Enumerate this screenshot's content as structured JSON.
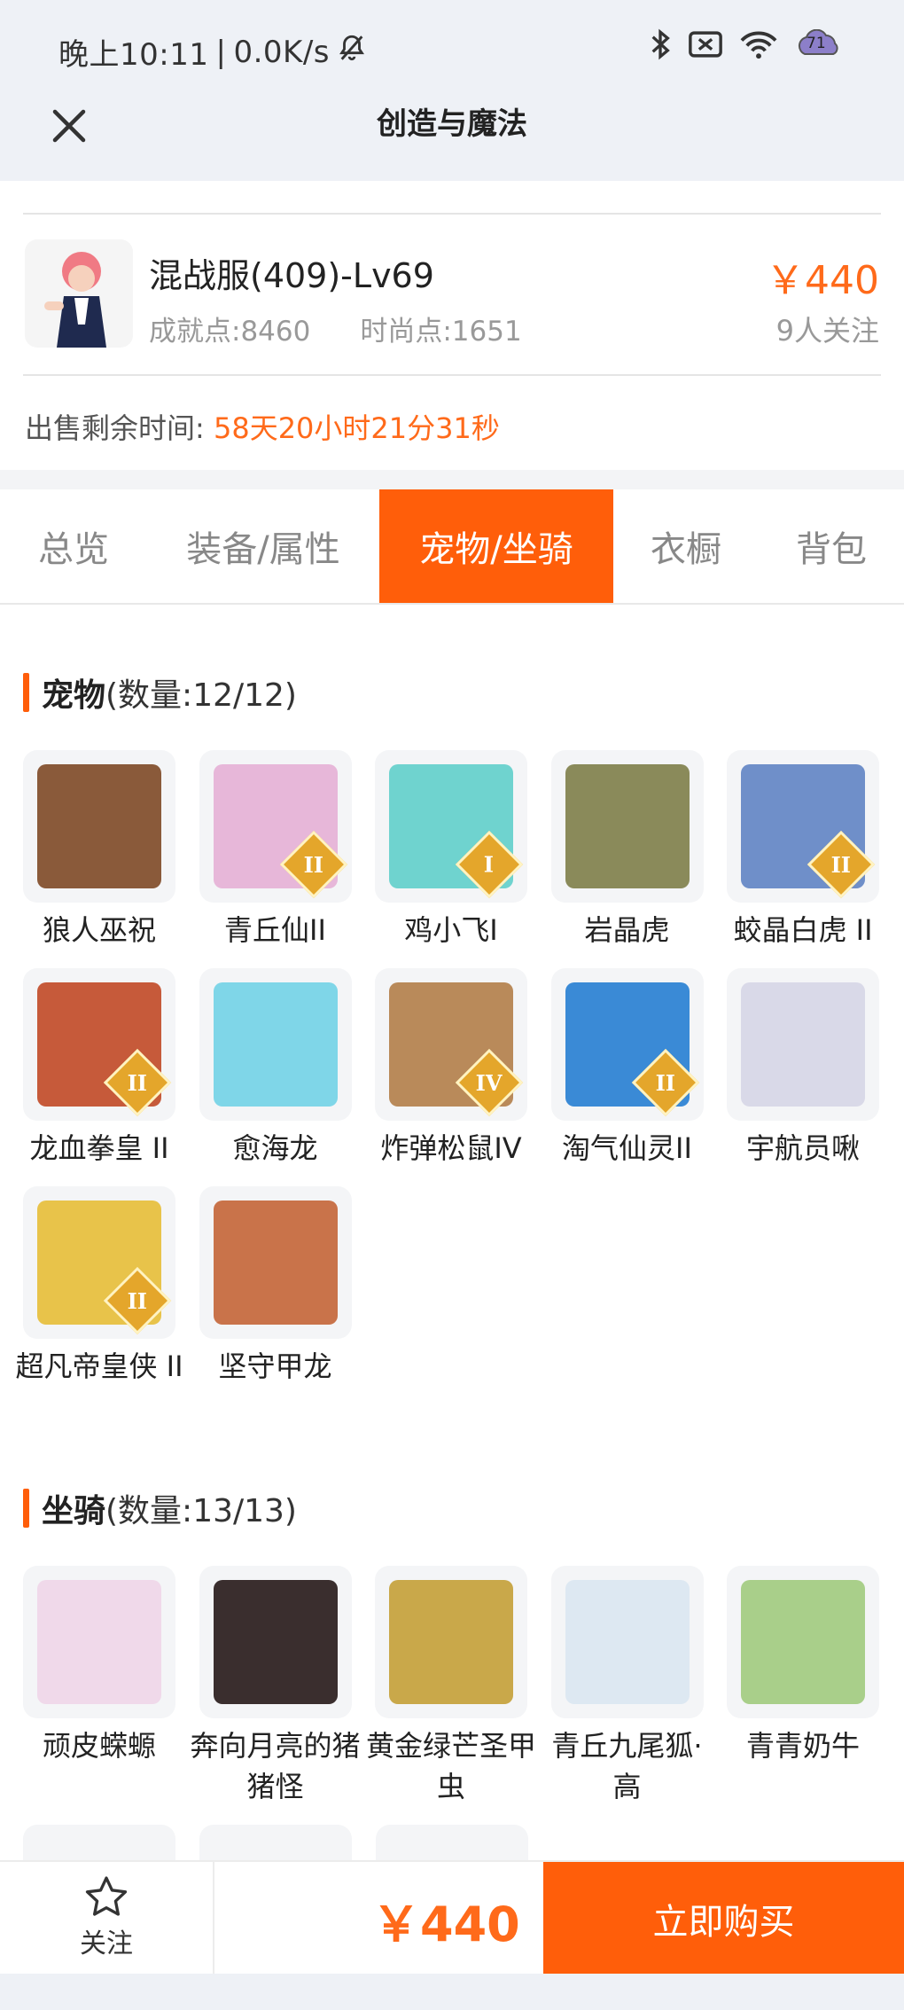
{
  "status_bar": {
    "time": "晚上10:11",
    "separator": "|",
    "network_speed": "0.0K/s",
    "battery": "71"
  },
  "header": {
    "title": "创造与魔法"
  },
  "product": {
    "name": "混战服(409)-Lv69",
    "achievement": "成就点:8460",
    "fashion": "时尚点:1651",
    "price": "￥440",
    "followers": "9人关注"
  },
  "sale": {
    "label": "出售剩余时间:",
    "time": "58天20小时21分31秒"
  },
  "tabs": [
    {
      "label": "总览",
      "active": false
    },
    {
      "label": "装备/属性",
      "active": false
    },
    {
      "label": "宠物/坐骑",
      "active": true
    },
    {
      "label": "衣橱",
      "active": false
    },
    {
      "label": "背包",
      "active": false
    }
  ],
  "pets": {
    "title": "宠物",
    "count": "(数量:12/12)",
    "items": [
      {
        "name": "狼人巫祝",
        "badge": "",
        "color": "#8a5a3a"
      },
      {
        "name": "青丘仙II",
        "badge": "II",
        "color": "#e7b7d9"
      },
      {
        "name": "鸡小飞I",
        "badge": "I",
        "color": "#6fd3cf"
      },
      {
        "name": "岩晶虎",
        "badge": "",
        "color": "#8a8a5a"
      },
      {
        "name": "蛟晶白虎 II",
        "badge": "II",
        "color": "#6f8fc9"
      },
      {
        "name": "龙血拳皇 II",
        "badge": "II",
        "color": "#c65a3a"
      },
      {
        "name": "愈海龙",
        "badge": "",
        "color": "#7fd6e8"
      },
      {
        "name": "炸弹松鼠IV",
        "badge": "IV",
        "color": "#b98a5a"
      },
      {
        "name": "淘气仙灵II",
        "badge": "II",
        "color": "#3a8ad6"
      },
      {
        "name": "宇航员啾",
        "badge": "",
        "color": "#d9d9e8"
      },
      {
        "name": "超凡帝皇侠 II",
        "badge": "II",
        "color": "#e8c34a"
      },
      {
        "name": "坚守甲龙",
        "badge": "",
        "color": "#c9734a"
      }
    ]
  },
  "mounts": {
    "title": "坐骑",
    "count": "(数量:13/13)",
    "items": [
      {
        "name": "顽皮蝾螈",
        "color": "#f0d9ea"
      },
      {
        "name": "奔向月亮的猪猪怪",
        "color": "#3a2e2e"
      },
      {
        "name": "黄金绿芒圣甲虫",
        "color": "#c9a84a"
      },
      {
        "name": "青丘九尾狐·高",
        "color": "#dde8f2"
      },
      {
        "name": "青青奶牛",
        "color": "#a9cf8a"
      }
    ]
  },
  "bottom_bar": {
    "follow_label": "关注",
    "price": "￥440",
    "buy_label": "立即购买"
  },
  "colors": {
    "accent": "#ff5e0a",
    "price": "#ff6a1a"
  }
}
